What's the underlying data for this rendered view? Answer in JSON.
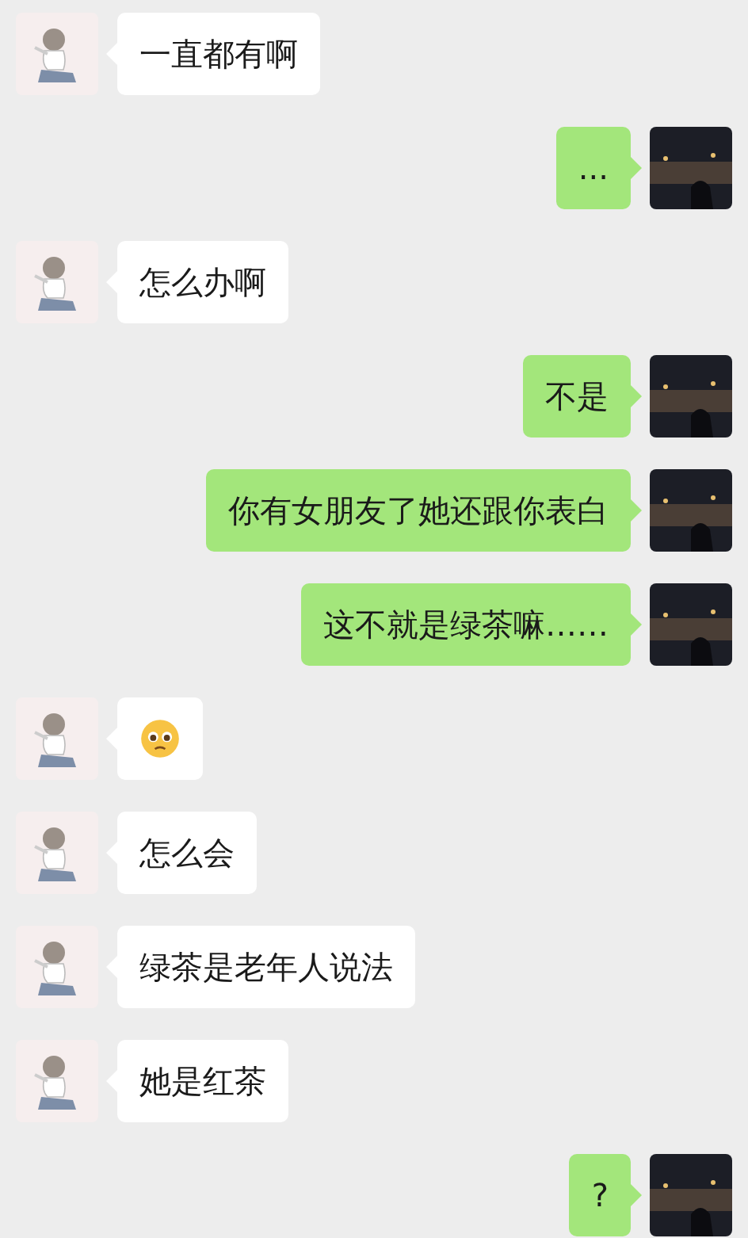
{
  "messages": [
    {
      "outgoing": false,
      "kind": "text",
      "text": "一直都有啊"
    },
    {
      "outgoing": true,
      "kind": "text",
      "text": "..."
    },
    {
      "outgoing": false,
      "kind": "text",
      "text": "怎么办啊"
    },
    {
      "outgoing": true,
      "kind": "text",
      "text": "不是"
    },
    {
      "outgoing": true,
      "kind": "text",
      "text": "你有女朋友了她还跟你表白"
    },
    {
      "outgoing": true,
      "kind": "text",
      "text": "这不就是绿茶嘛……"
    },
    {
      "outgoing": false,
      "kind": "emoji"
    },
    {
      "outgoing": false,
      "kind": "text",
      "text": "怎么会"
    },
    {
      "outgoing": false,
      "kind": "text",
      "text": "绿茶是老年人说法"
    },
    {
      "outgoing": false,
      "kind": "text",
      "text": "她是红茶"
    },
    {
      "outgoing": true,
      "kind": "text",
      "text": "?"
    }
  ]
}
